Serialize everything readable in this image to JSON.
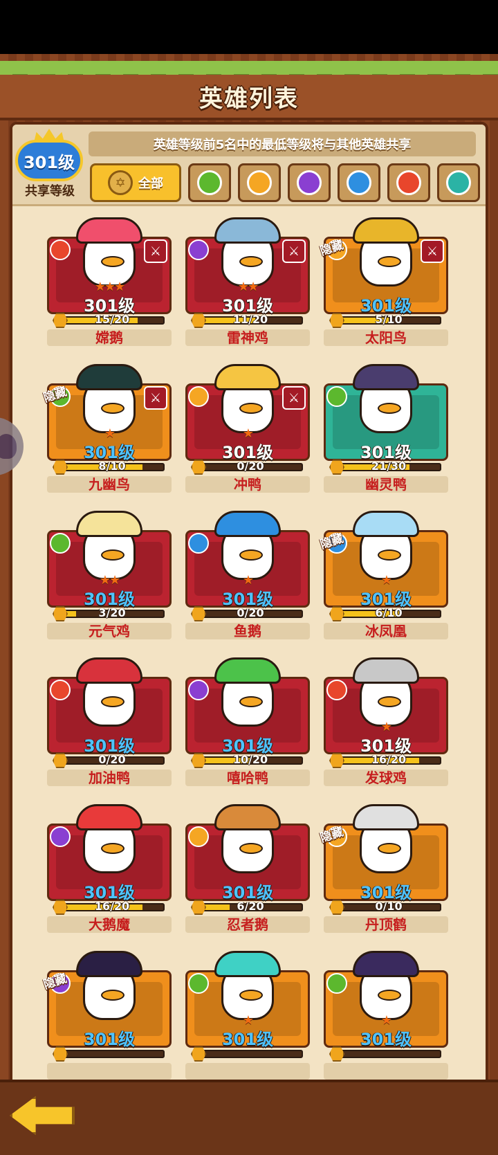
{
  "title": "英雄列表",
  "shared_level": {
    "value": "301级",
    "label": "共享等级"
  },
  "share_note": "英雄等级前5名中的最低等级将与其他英雄共享",
  "filters": [
    {
      "name": "全部",
      "icon": "star-of-david-icon",
      "color": "#e2b04a"
    },
    {
      "icon": "leaf-element-icon",
      "color": "#5cb82e"
    },
    {
      "icon": "sun-element-icon",
      "color": "#f5a623"
    },
    {
      "icon": "shadow-element-icon",
      "color": "#8a3fd1"
    },
    {
      "icon": "ice-element-icon",
      "color": "#2e8fe0"
    },
    {
      "icon": "fire-element-icon",
      "color": "#e8462c"
    },
    {
      "icon": "wind-element-icon",
      "color": "#2bb3a5"
    }
  ],
  "heroes": [
    {
      "name": "嫦鹅",
      "level": "301级",
      "level_color": "white",
      "stars": "★★★",
      "xp": "15/20",
      "xp_fraction": 0.75,
      "bg": "red",
      "element_color": "#e8462c",
      "role": "sword",
      "hidden": "",
      "hat_color": "#f04f6c"
    },
    {
      "name": "雷神鸡",
      "level": "301级",
      "level_color": "white",
      "stars": "★★",
      "xp": "11/20",
      "xp_fraction": 0.55,
      "bg": "red",
      "element_color": "#8a3fd1",
      "role": "sword",
      "hidden": "",
      "hat_color": "#8ab8d8"
    },
    {
      "name": "太阳鸟",
      "level": "301级",
      "level_color": "blue",
      "stars": "",
      "xp": "5/10",
      "xp_fraction": 0.5,
      "bg": "orange",
      "element_color": "#f5a623",
      "role": "sword",
      "hidden": "隐藏",
      "hat_color": "#e8b52a"
    },
    {
      "name": "九幽鸟",
      "level": "301级",
      "level_color": "blue",
      "stars": "★",
      "xp": "8/10",
      "xp_fraction": 0.8,
      "bg": "orange",
      "element_color": "#5cb82e",
      "role": "sword",
      "hidden": "隐藏",
      "hat_color": "#1f3c3a"
    },
    {
      "name": "冲鸭",
      "level": "301级",
      "level_color": "white",
      "stars": "★",
      "xp": "0/20",
      "xp_fraction": 0.02,
      "bg": "red",
      "element_color": "#f5a623",
      "role": "sword",
      "hidden": "",
      "hat_color": "#f5c542"
    },
    {
      "name": "幽灵鸭",
      "level": "301级",
      "level_color": "white",
      "stars": "",
      "xp": "21/30",
      "xp_fraction": 0.7,
      "bg": "teal",
      "element_color": "#5cb82e",
      "role": "",
      "hidden": "",
      "hat_color": "#4a3d6e"
    },
    {
      "name": "元气鸡",
      "level": "301级",
      "level_color": "blue",
      "stars": "★★",
      "xp": "3/20",
      "xp_fraction": 0.15,
      "bg": "red",
      "element_color": "#5cb82e",
      "role": "",
      "hidden": "",
      "hat_color": "#f5e39a"
    },
    {
      "name": "鱼鹅",
      "level": "301级",
      "level_color": "blue",
      "stars": "★",
      "xp": "0/20",
      "xp_fraction": 0.02,
      "bg": "red",
      "element_color": "#2e8fe0",
      "role": "",
      "hidden": "",
      "hat_color": "#2e8fe0"
    },
    {
      "name": "冰凤凰",
      "level": "301级",
      "level_color": "blue",
      "stars": "★",
      "xp": "6/10",
      "xp_fraction": 0.6,
      "bg": "orange",
      "element_color": "#2e8fe0",
      "role": "",
      "hidden": "隐藏",
      "hat_color": "#a8dcf5"
    },
    {
      "name": "加油鸭",
      "level": "301级",
      "level_color": "blue",
      "stars": "",
      "xp": "0/20",
      "xp_fraction": 0.02,
      "bg": "red",
      "element_color": "#e8462c",
      "role": "",
      "hidden": "",
      "hat_color": "#d8323c"
    },
    {
      "name": "嘻哈鸭",
      "level": "301级",
      "level_color": "blue",
      "stars": "",
      "xp": "10/20",
      "xp_fraction": 0.5,
      "bg": "red",
      "element_color": "#8a3fd1",
      "role": "",
      "hidden": "",
      "hat_color": "#4cc24a"
    },
    {
      "name": "发球鸡",
      "level": "301级",
      "level_color": "white",
      "stars": "★",
      "xp": "16/20",
      "xp_fraction": 0.8,
      "bg": "red",
      "element_color": "#e8462c",
      "role": "",
      "hidden": "",
      "hat_color": "#c8c8c8"
    },
    {
      "name": "大鹅魔",
      "level": "301级",
      "level_color": "blue",
      "stars": "",
      "xp": "16/20",
      "xp_fraction": 0.8,
      "bg": "red",
      "element_color": "#8a3fd1",
      "role": "",
      "hidden": "",
      "hat_color": "#e83a3a"
    },
    {
      "name": "忍者鹅",
      "level": "301级",
      "level_color": "blue",
      "stars": "",
      "xp": "6/20",
      "xp_fraction": 0.3,
      "bg": "red",
      "element_color": "#f5a623",
      "role": "",
      "hidden": "",
      "hat_color": "#d98a3a"
    },
    {
      "name": "丹顶鹤",
      "level": "301级",
      "level_color": "blue",
      "stars": "",
      "xp": "0/10",
      "xp_fraction": 0.02,
      "bg": "orange",
      "element_color": "#f5a623",
      "role": "",
      "hidden": "隐藏",
      "hat_color": "#e0e0e0"
    },
    {
      "name": "",
      "level": "301级",
      "level_color": "blue",
      "stars": "",
      "xp": "",
      "xp_fraction": 0.0,
      "bg": "orange",
      "element_color": "#8a3fd1",
      "role": "",
      "hidden": "隐藏",
      "hat_color": "#2a1f44"
    },
    {
      "name": "",
      "level": "301级",
      "level_color": "blue",
      "stars": "★",
      "xp": "",
      "xp_fraction": 0.0,
      "bg": "orange",
      "element_color": "#5cb82e",
      "role": "",
      "hidden": "",
      "hat_color": "#3fd1c5"
    },
    {
      "name": "",
      "level": "301级",
      "level_color": "blue",
      "stars": "★",
      "xp": "",
      "xp_fraction": 0.0,
      "bg": "orange",
      "element_color": "#5cb82e",
      "role": "",
      "hidden": "",
      "hat_color": "#3a2a5e"
    }
  ]
}
